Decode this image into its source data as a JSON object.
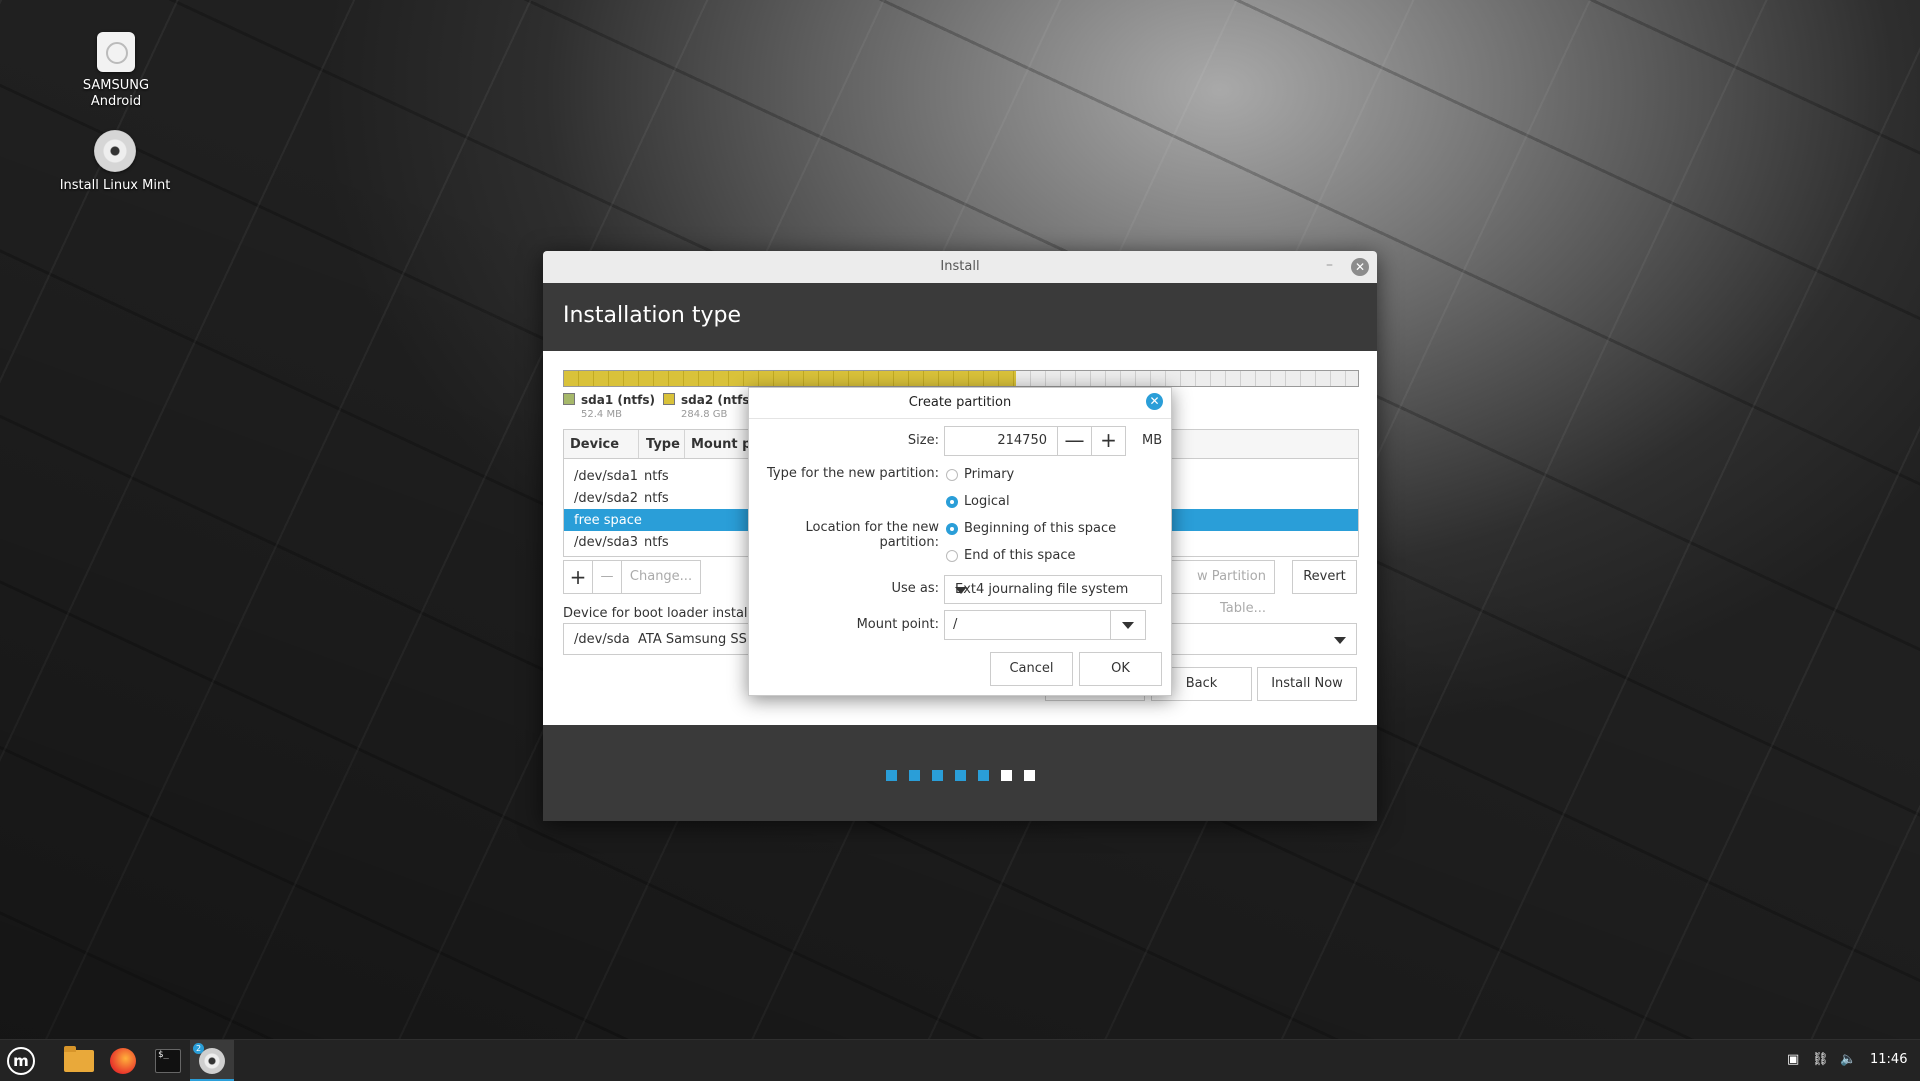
{
  "desktop": {
    "icons": [
      {
        "label_line1": "SAMSUNG",
        "label_line2": "Android",
        "icon": "usb-drive-icon"
      },
      {
        "label_line1": "Install Linux Mint",
        "icon": "cd-disc-icon"
      }
    ]
  },
  "window": {
    "title": "Install",
    "heading": "Installation type",
    "legend": [
      {
        "name": "sda1 (ntfs)",
        "size": "52.4 MB",
        "color": "#a6b86a"
      },
      {
        "name": "sda2 (ntfs)",
        "size": "284.8 GB",
        "color": "#d9c23a"
      }
    ],
    "table": {
      "headers": [
        "Device",
        "Type",
        "Mount po"
      ],
      "rows": [
        {
          "device": "/dev/sda1",
          "type": "ntfs"
        },
        {
          "device": "/dev/sda2",
          "type": "ntfs"
        },
        {
          "device": "free space",
          "type": "",
          "selected": true
        },
        {
          "device": "/dev/sda3",
          "type": "ntfs"
        }
      ]
    },
    "toolbar": {
      "add": "+",
      "remove": "—",
      "change": "Change...",
      "new_table": "w Partition Table...",
      "revert": "Revert"
    },
    "bootloader": {
      "label": "Device for boot loader installat",
      "device": "/dev/sda",
      "description": "ATA Samsung SSD"
    },
    "nav": {
      "back": "Back",
      "install_now": "Install Now"
    },
    "progress": {
      "steps_total": 7,
      "steps_done": 5
    }
  },
  "dialog": {
    "title": "Create partition",
    "size_label": "Size:",
    "size_value": "214750",
    "size_unit": "MB",
    "minus": "—",
    "plus": "+",
    "type_label": "Type for the new partition:",
    "type_options": [
      "Primary",
      "Logical"
    ],
    "type_selected": "Logical",
    "location_label": "Location for the new partition:",
    "location_options": [
      "Beginning of this space",
      "End of this space"
    ],
    "location_selected": "Beginning of this space",
    "use_as_label": "Use as:",
    "use_as_value": "Ext4 journaling file system",
    "mount_label": "Mount point:",
    "mount_value": "/",
    "cancel": "Cancel",
    "ok": "OK"
  },
  "taskbar": {
    "clock": "11:46",
    "badge": "2",
    "accent": "#2a9ed8"
  }
}
